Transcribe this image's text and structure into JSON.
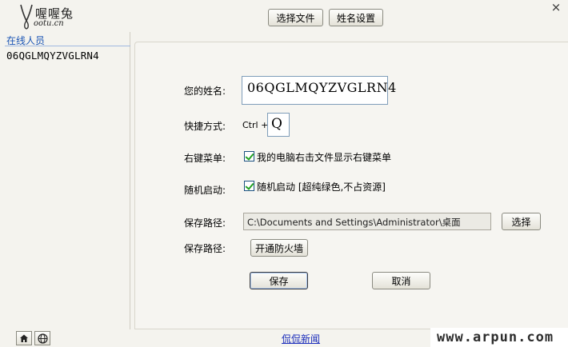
{
  "header": {
    "brand": "喔喔兔",
    "domain": "ootu.cn",
    "select_file_label": "选择文件",
    "name_settings_label": "姓名设置",
    "close_glyph": "×"
  },
  "sidebar": {
    "online_label": "在线人员",
    "users": [
      "06QGLMQYZVGLRN4"
    ]
  },
  "form": {
    "name_label": "您的姓名:",
    "name_value": "06QGLMQYZVGLRN4",
    "shortcut_label": "快捷方式:",
    "shortcut_modifier": "Ctrl +",
    "shortcut_key": "Q",
    "context_menu_label": "右键菜单:",
    "context_menu_option": "我的电脑右击文件显示右键菜单",
    "context_menu_checked": true,
    "autostart_label": "随机启动:",
    "autostart_option": "随机启动 [超纯绿色,不占资源]",
    "autostart_checked": true,
    "save_path_label": "保存路径:",
    "save_path_value": "C:\\Documents and Settings\\Administrator\\桌面",
    "choose_label": "选择",
    "firewall_row_label": "保存路径:",
    "firewall_button_label": "开通防火墙",
    "save_label": "保存",
    "cancel_label": "取消"
  },
  "footer": {
    "news_link": "侃侃新闻",
    "watermark": "www.arpun.com"
  }
}
